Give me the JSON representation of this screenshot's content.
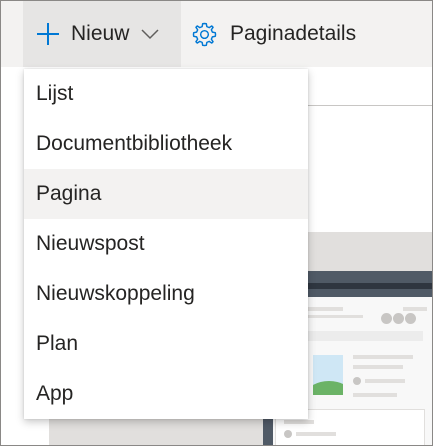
{
  "commandbar": {
    "new_label": "Nieuw",
    "page_details_label": "Paginadetails",
    "accent_color": "#0078d4"
  },
  "menu": {
    "items": [
      {
        "label": "Lijst"
      },
      {
        "label": "Documentbibliotheek"
      },
      {
        "label": "Pagina",
        "highlighted": true
      },
      {
        "label": "Nieuwspost"
      },
      {
        "label": "Nieuwskoppeling"
      },
      {
        "label": "Plan"
      },
      {
        "label": "App"
      }
    ]
  },
  "icons": {
    "new": "plus-icon",
    "expand": "chevron-down-icon",
    "details": "gear-icon"
  }
}
